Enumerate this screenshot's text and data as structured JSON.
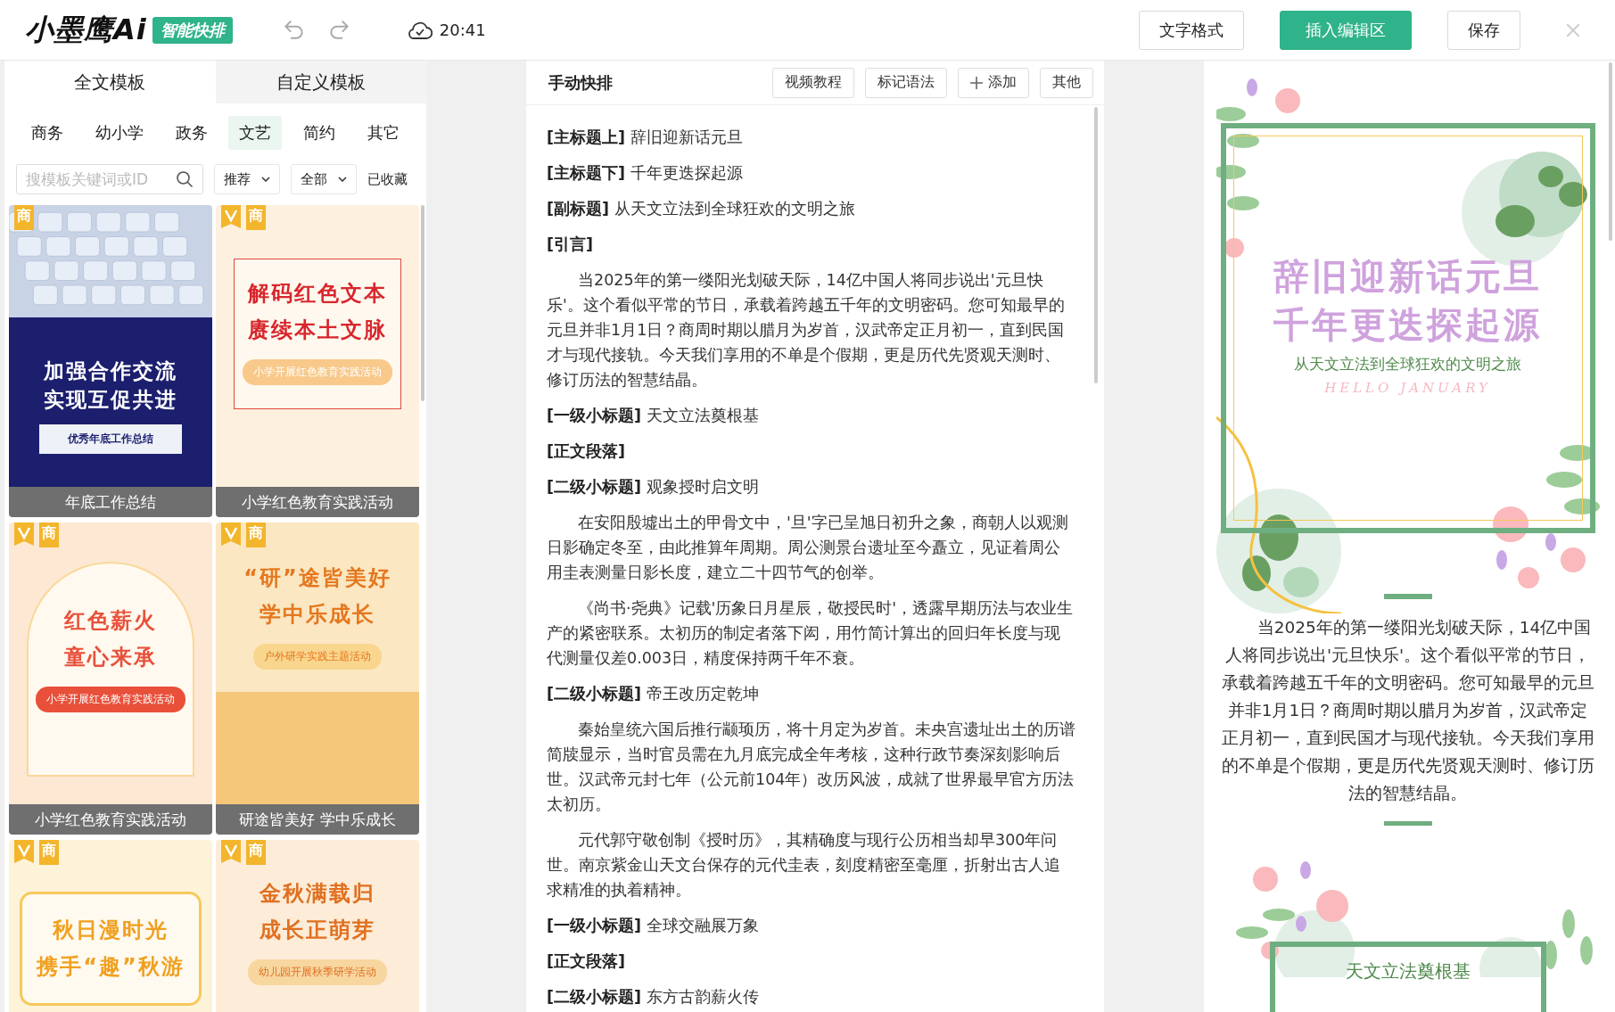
{
  "app": {
    "logo": "小墨鹰Ai",
    "badge": "智能快排",
    "save_time": "20:41"
  },
  "toolbar_buttons": [
    {
      "label": "文字格式",
      "kind": "outline"
    },
    {
      "label": "插入编辑区",
      "kind": "primary"
    },
    {
      "label": "保存",
      "kind": "outline"
    }
  ],
  "template_panel": {
    "tabs": [
      {
        "label": "全文模板",
        "selected": true
      },
      {
        "label": "自定义模板",
        "selected": false
      }
    ],
    "categories": [
      {
        "label": "商务",
        "selected": false
      },
      {
        "label": "幼小学",
        "selected": false
      },
      {
        "label": "政务",
        "selected": false
      },
      {
        "label": "文艺",
        "selected": true
      },
      {
        "label": "简约",
        "selected": false
      },
      {
        "label": "其它",
        "selected": false
      }
    ],
    "search": {
      "placeholder": "搜模板关键词或ID"
    },
    "filters": [
      {
        "label": "推荐",
        "kind": "dropdown"
      },
      {
        "label": "全部",
        "kind": "dropdown"
      },
      {
        "label": "已收藏",
        "kind": "link"
      }
    ],
    "templates": [
      {
        "kind": "navy",
        "vip": false,
        "badge": "商",
        "title_lines": [
          "加强合作交流",
          "实现互促共进"
        ],
        "tag": "优秀年底工作总结",
        "caption": "年底工作总结"
      },
      {
        "kind": "red",
        "vip": true,
        "badge": "商",
        "title_lines": [
          "解码红色文本",
          "赓续本土文脉"
        ],
        "tag": "小学开展红色教育实践活动",
        "caption": "小学红色教育实践活动"
      },
      {
        "kind": "arch",
        "vip": true,
        "badge": "商",
        "title_lines": [
          "红色薪火",
          "童心来承"
        ],
        "tag": "小学开展红色教育实践活动",
        "caption": "小学红色教育实践活动"
      },
      {
        "kind": "autumn",
        "vip": true,
        "badge": "商",
        "title_lines": [
          "“研”途皆美好",
          "学中乐成长"
        ],
        "tag": "户外研学实践主题活动",
        "caption": "研途皆美好 学中乐成长"
      },
      {
        "kind": "ginkgo",
        "vip": true,
        "badge": "商",
        "title_lines": [
          "秋日漫时光",
          "携手“趣”秋游"
        ]
      },
      {
        "kind": "kite",
        "vip": true,
        "badge": "商",
        "title_lines": [
          "金秋满载归",
          "成长正萌芽"
        ],
        "tag": "幼儿园开展秋季研学活动"
      }
    ]
  },
  "editor": {
    "title": "手动快排",
    "buttons": [
      {
        "label": "视频教程",
        "kind": "plain"
      },
      {
        "label": "标记语法",
        "kind": "plain"
      },
      {
        "label": "添加",
        "kind": "add"
      },
      {
        "label": "其他",
        "kind": "plain"
      }
    ],
    "blocks": [
      {
        "kind": "marker",
        "text": "**[主标题上]** 辞旧迎新话元旦"
      },
      {
        "kind": "marker",
        "text": "**[主标题下]** 千年更迭探起源"
      },
      {
        "kind": "marker",
        "text": "**[副标题]** 从天文立法到全球狂欢的文明之旅"
      },
      {
        "kind": "label",
        "text": "[引言]"
      },
      {
        "kind": "paragraph",
        "text": "当2025年的第一缕阳光划破天际，14亿中国人将同步说出'元旦快乐'。这个看似平常的节日，承载着跨越五千年的文明密码。您可知最早的元旦并非1月1日？商周时期以腊月为岁首，汉武帝定正月初一，直到民国才与现代接轨。今天我们享用的不单是个假期，更是历代先贤观天测时、修订历法的智慧结晶。"
      },
      {
        "kind": "marker",
        "text": "**[一级小标题]** 天文立法奠根基"
      },
      {
        "kind": "label",
        "text": "[正文段落]"
      },
      {
        "kind": "marker",
        "text": "**[二级小标题]** 观象授时启文明"
      },
      {
        "kind": "paragraph",
        "text": "在安阳殷墟出土的甲骨文中，'旦'字已呈旭日初升之象，商朝人以观测日影确定冬至，由此推算年周期。周公测景台遗址至今矗立，见证着周公用圭表测量日影长度，建立二十四节气的创举。"
      },
      {
        "kind": "paragraph",
        "text": "《尚书·尧典》记载'历象日月星辰，敬授民时'，透露早期历法与农业生产的紧密联系。太初历的制定者落下闳，用竹简计算出的回归年长度与现代测量仅差0.003日，精度保持两千年不衰。"
      },
      {
        "kind": "marker",
        "text": "**[二级小标题]** 帝王改历定乾坤"
      },
      {
        "kind": "paragraph",
        "text": "秦始皇统六国后推行颛顼历，将十月定为岁首。未央宫遗址出土的历谱简牍显示，当时官员需在九月底完成全年考核，这种行政节奏深刻影响后世。汉武帝元封七年（公元前104年）改历风波，成就了世界最早官方历法太初历。"
      },
      {
        "kind": "paragraph",
        "text": "元代郭守敬创制《授时历》，其精确度与现行公历相当却早300年问世。南京紫金山天文台保存的元代圭表，刻度精密至毫厘，折射出古人追求精准的执着精神。"
      },
      {
        "kind": "marker",
        "text": "**[一级小标题]** 全球交融展万象"
      },
      {
        "kind": "label",
        "text": "[正文段落]"
      },
      {
        "kind": "marker",
        "text": "**[二级小标题]** 东方古韵薪火传"
      }
    ]
  },
  "preview": {
    "title_lines": [
      "辞旧迎新话元旦",
      "千年更迭探起源"
    ],
    "subtitle": "从天文立法到全球狂欢的文明之旅",
    "script": "HELLO JANUARY",
    "paragraph": "当2025年的第一缕阳光划破天际，14亿中国人将同步说出'元旦快乐'。这个看似平常的节日，承载着跨越五千年的文明密码。您可知最早的元旦并非1月1日？商周时期以腊月为岁首，汉武帝定正月初一，直到民国才与现代接轨。今天我们享用的不单是个假期，更是历代先贤观天测时、修订历法的智慧结晶。",
    "section_heading": "天文立法奠根基"
  }
}
